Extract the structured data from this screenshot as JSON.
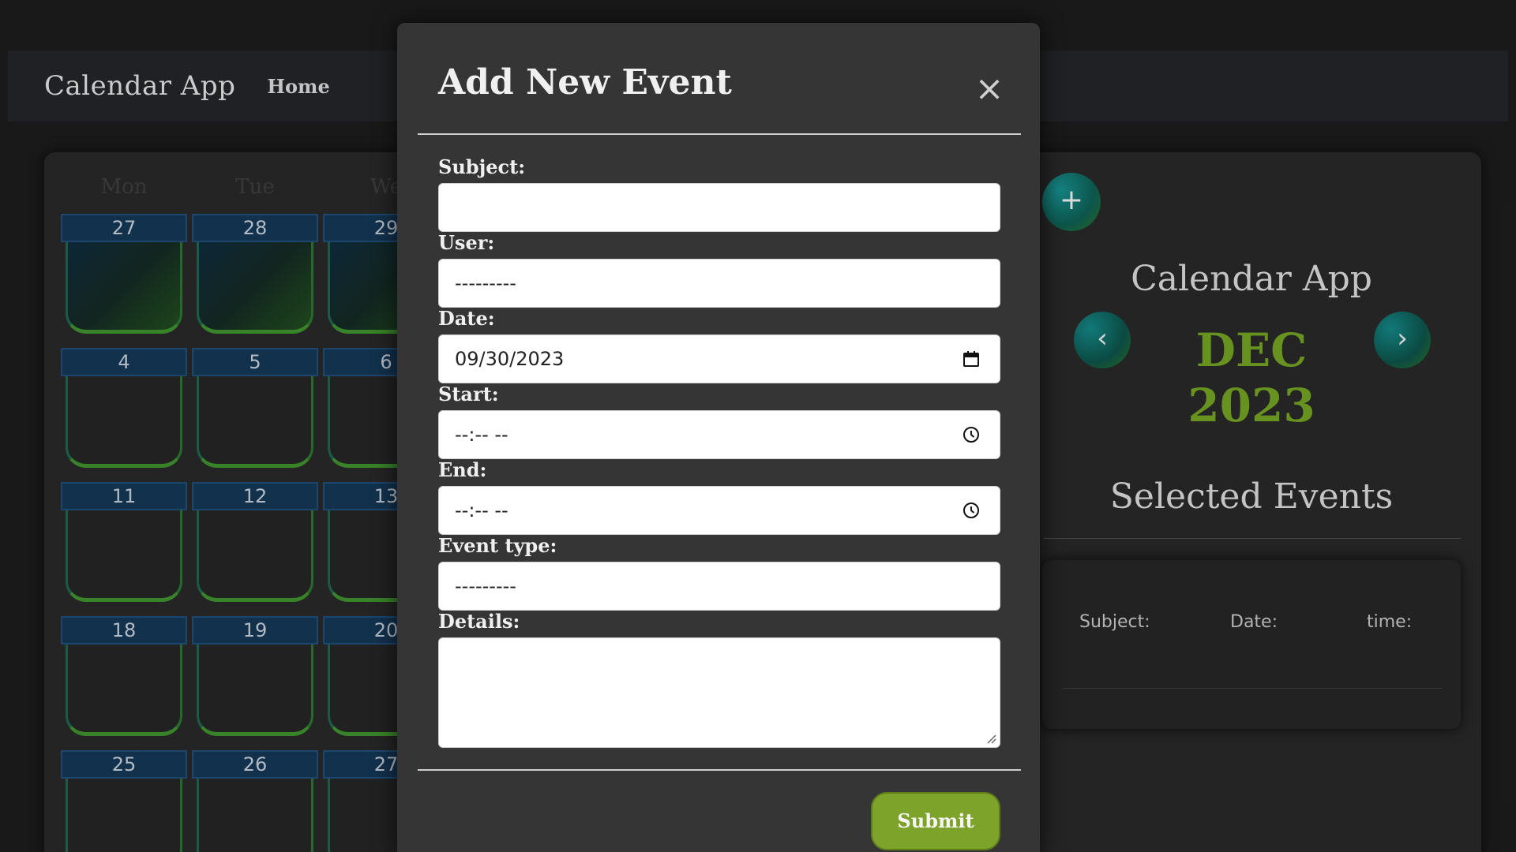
{
  "navbar": {
    "brand": "Calendar App",
    "home": "Home"
  },
  "calendar": {
    "weekdays": [
      "Mon",
      "Tue",
      "We"
    ],
    "rows": [
      [
        "27",
        "28",
        "29"
      ],
      [
        "4",
        "5",
        "6"
      ],
      [
        "11",
        "12",
        "13"
      ],
      [
        "18",
        "19",
        "20"
      ],
      [
        "25",
        "26",
        "27"
      ]
    ]
  },
  "sidebar": {
    "add_icon": "+",
    "title": "Calendar App",
    "month": "DEC",
    "year": "2023",
    "prev_icon": "‹",
    "next_icon": "›",
    "selected_title": "Selected Events",
    "columns": [
      "Subject:",
      "Date:",
      "time:"
    ]
  },
  "modal": {
    "title": "Add New Event",
    "close_icon": "×",
    "labels": {
      "subject": "Subject:",
      "user": "User:",
      "date": "Date:",
      "start": "Start:",
      "end": "End:",
      "event_type": "Event type:",
      "details": "Details:"
    },
    "values": {
      "subject": "",
      "user": "---------",
      "date": "09/30/2023",
      "start": "--:-- --",
      "end": "--:-- --",
      "event_type": "---------",
      "details": ""
    },
    "submit": "Submit"
  },
  "colors": {
    "accent_green": "#7ea32a",
    "month_green": "#6e9a22",
    "day_header_blue": "#143451"
  }
}
